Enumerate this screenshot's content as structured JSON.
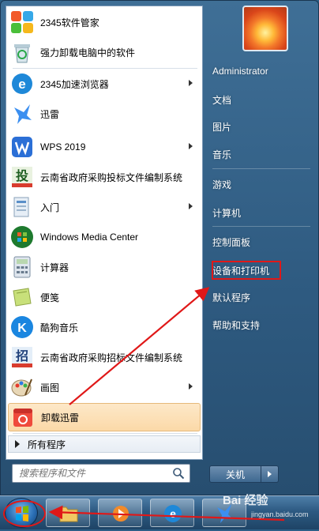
{
  "programs": [
    {
      "label": "2345软件管家",
      "icon": "software-manager-icon",
      "arrow": false
    },
    {
      "label": "强力卸载电脑中的软件",
      "icon": "recycle-uninstall-icon",
      "arrow": false
    },
    {
      "label": "2345加速浏览器",
      "icon": "browser-icon",
      "arrow": true
    },
    {
      "label": "迅雷",
      "icon": "thunder-bird-icon",
      "arrow": false
    },
    {
      "label": "WPS 2019",
      "icon": "wps-icon",
      "arrow": true
    },
    {
      "label": "云南省政府采购投标文件编制系统",
      "icon": "bid-system-icon",
      "arrow": false
    },
    {
      "label": "入门",
      "icon": "getting-started-icon",
      "arrow": true
    },
    {
      "label": "Windows Media Center",
      "icon": "media-center-icon",
      "arrow": false
    },
    {
      "label": "计算器",
      "icon": "calculator-icon",
      "arrow": false
    },
    {
      "label": "便笺",
      "icon": "sticky-notes-icon",
      "arrow": false
    },
    {
      "label": "酷狗音乐",
      "icon": "kugou-music-icon",
      "arrow": false
    },
    {
      "label": "云南省政府采购招标文件编制系统",
      "icon": "tender-system-icon",
      "arrow": false
    },
    {
      "label": "画图",
      "icon": "paint-icon",
      "arrow": true
    },
    {
      "label": "卸载迅雷",
      "icon": "uninstall-thunder-icon",
      "arrow": false
    }
  ],
  "all_programs": "所有程序",
  "search": {
    "placeholder": "搜索程序和文件"
  },
  "right_menu": [
    "Administrator",
    "文档",
    "图片",
    "音乐",
    "游戏",
    "计算机",
    "控制面板",
    "设备和打印机",
    "默认程序",
    "帮助和支持"
  ],
  "shutdown_label": "关机",
  "watermark": {
    "main": "Bai 经验",
    "sub": "jingyan.baidu.com"
  },
  "colors": {
    "highlight_red": "#e01818",
    "hover_item": "#fbd9a8"
  }
}
